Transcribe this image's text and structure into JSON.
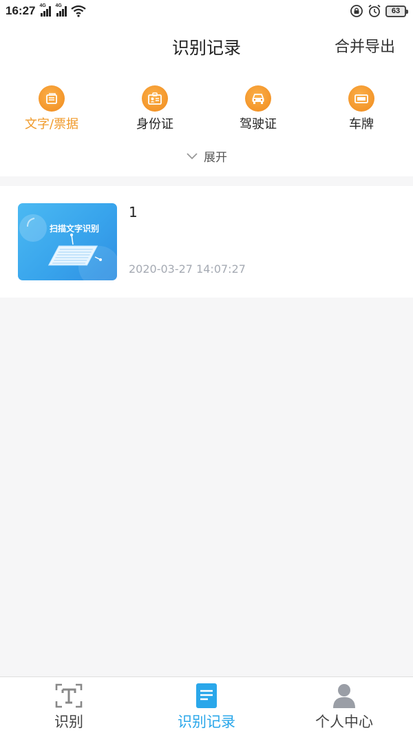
{
  "status_bar": {
    "time": "16:27",
    "signal1_label": "4G",
    "signal2_label": "4G",
    "battery": "63",
    "icons": [
      "wifi-icon",
      "lock-rotation-icon",
      "alarm-icon",
      "battery-icon"
    ]
  },
  "header": {
    "title": "识别记录",
    "action_label": "合并导出"
  },
  "categories": [
    {
      "label": "文字/票据",
      "icon": "document-icon",
      "active": true
    },
    {
      "label": "身份证",
      "icon": "id-card-icon",
      "active": false
    },
    {
      "label": "驾驶证",
      "icon": "car-icon",
      "active": false
    },
    {
      "label": "车牌",
      "icon": "license-plate-icon",
      "active": false
    }
  ],
  "expand_label": "展开",
  "records": [
    {
      "title": "1",
      "timestamp": "2020-03-27 14:07:27",
      "thumbnail_text": "扫描文字识别"
    }
  ],
  "bottom_nav": [
    {
      "label": "识别",
      "icon": "text-scan-icon",
      "active": false
    },
    {
      "label": "识别记录",
      "icon": "records-icon",
      "active": true
    },
    {
      "label": "个人中心",
      "icon": "person-icon",
      "active": false
    }
  ],
  "colors": {
    "accent_orange": "#f09a2a",
    "accent_blue": "#2aa7ea",
    "background": "#f6f6f7",
    "timestamp_gray": "#a5aab3"
  }
}
